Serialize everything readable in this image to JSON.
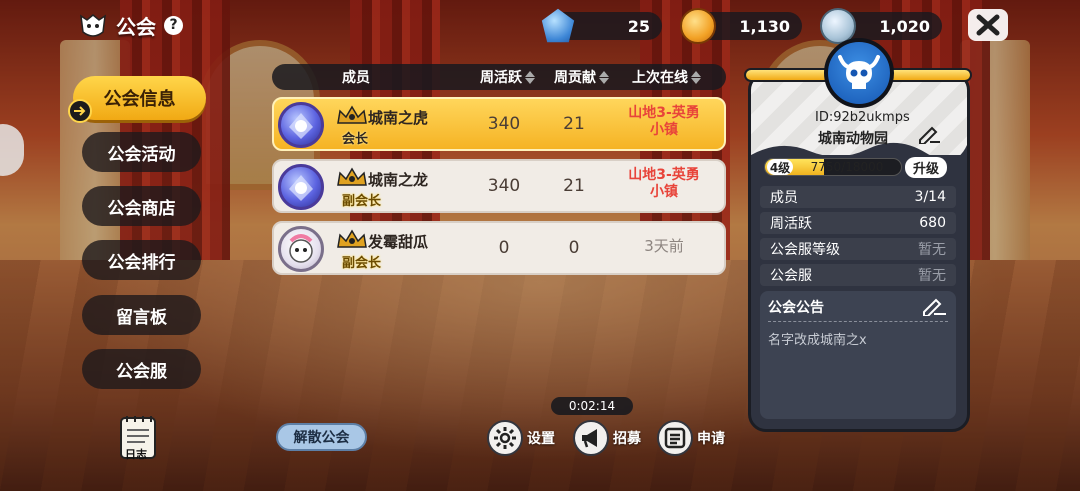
{
  "header": {
    "title": "公会",
    "help": "?"
  },
  "currency": {
    "gems": "25",
    "coins": "1,130",
    "silver": "1,020"
  },
  "nav": {
    "active": "公会信息",
    "items": [
      "公会活动",
      "公会商店",
      "公会排行",
      "留言板",
      "公会服"
    ],
    "log": "日志"
  },
  "table": {
    "headers": {
      "member": "成员",
      "weekly_active": "周活跃",
      "weekly_contrib": "周贡献",
      "last_online": "上次在线"
    },
    "rows": [
      {
        "name": "城南之虎",
        "role": "会长",
        "weekly_active": "340",
        "weekly_contrib": "21",
        "last_online_1": "山地3-英勇",
        "last_online_2": "小镇"
      },
      {
        "name": "城南之龙",
        "role": "副会长",
        "weekly_active": "340",
        "weekly_contrib": "21",
        "last_online_1": "山地3-英勇",
        "last_online_2": "小镇"
      },
      {
        "name": "发霉甜瓜",
        "role": "副会长",
        "weekly_active": "0",
        "weekly_contrib": "0",
        "last_online_1": "3天前",
        "last_online_2": ""
      }
    ]
  },
  "guild": {
    "id": "ID:92b2ukmps",
    "name": "城南动物园",
    "level": "4级",
    "exp_text": "7750/18000",
    "exp_fraction": 0.4306,
    "upgrade": "升级",
    "stats": [
      {
        "label": "成员",
        "value": "3/14"
      },
      {
        "label": "周活跃",
        "value": "680"
      },
      {
        "label": "公会服等级",
        "value": "暂无"
      },
      {
        "label": "公会服",
        "value": "暂无"
      }
    ],
    "notice_title": "公会公告",
    "notice_text": "名字改成城南之x"
  },
  "bottom": {
    "timer": "0:02:14",
    "disband": "解散公会",
    "settings": "设置",
    "recruit": "招募",
    "apply": "申请"
  },
  "colors": {
    "accent": "#f5b324",
    "panel": "#2f3340",
    "online_red": "#e8443a"
  }
}
